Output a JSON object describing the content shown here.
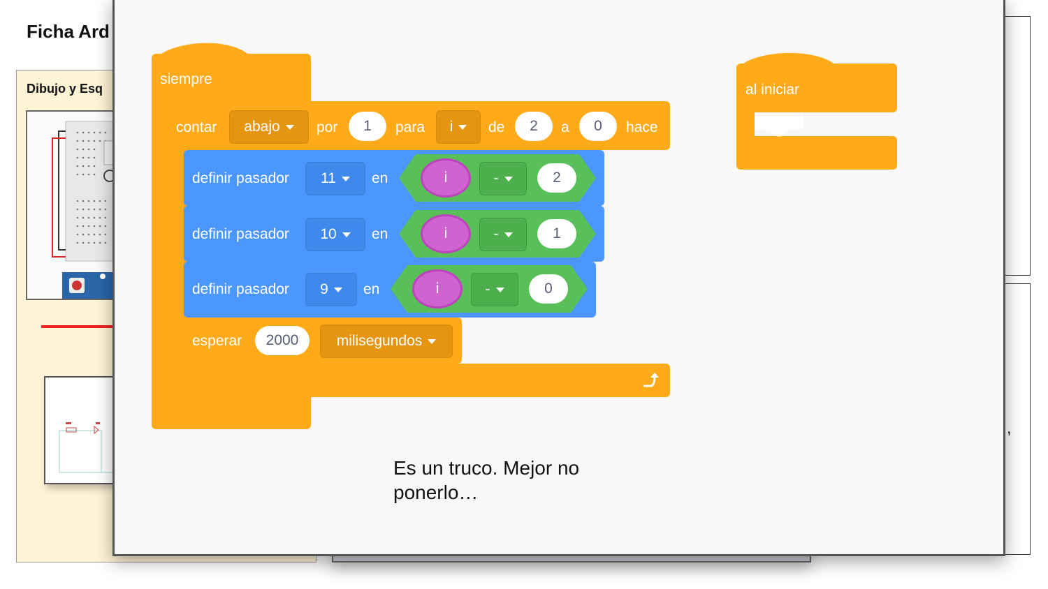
{
  "background_slide": {
    "title": "Ficha Ard",
    "panel_title": "Dibujo y Esq",
    "comma": ","
  },
  "note": {
    "text": "Es un truco. Mejor no ponerlo…"
  },
  "blocks": {
    "forever_label": "siempre",
    "count": {
      "label": "contar",
      "direction": "abajo",
      "by_label": "por",
      "by_value": "1",
      "for_label": "para",
      "var": "i",
      "from_label": "de",
      "from_value": "2",
      "to_label": "a",
      "to_value": "0",
      "do_label": "hace"
    },
    "set_pins": [
      {
        "label": "definir pasador",
        "pin": "11",
        "in_label": "en",
        "var": "i",
        "op": "-",
        "value": "2"
      },
      {
        "label": "definir pasador",
        "pin": "10",
        "in_label": "en",
        "var": "i",
        "op": "-",
        "value": "1"
      },
      {
        "label": "definir pasador",
        "pin": "9",
        "in_label": "en",
        "var": "i",
        "op": "-",
        "value": "0"
      }
    ],
    "wait": {
      "label": "esperar",
      "value": "2000",
      "unit": "milisegundos"
    },
    "on_start_label": "al iniciar"
  },
  "colors": {
    "control": "#ffab19",
    "output": "#4c97ff",
    "math": "#59c059",
    "variable": "#cf63cf"
  },
  "icons": [
    "loop-arrow-icon",
    "dropdown-caret-icon"
  ]
}
